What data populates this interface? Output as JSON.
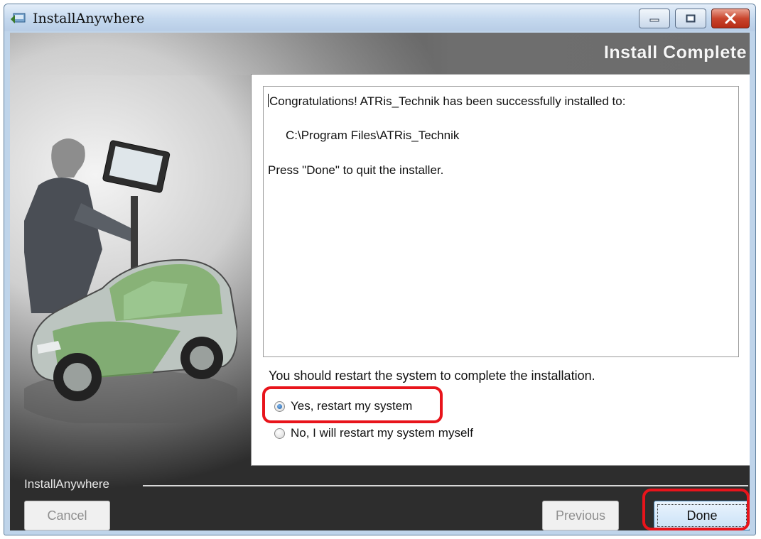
{
  "window": {
    "title": "InstallAnywhere"
  },
  "header": {
    "step_title": "Install Complete"
  },
  "message": {
    "line1": "Congratulations! ATRis_Technik has been successfully installed to:",
    "install_path": "C:\\Program Files\\ATRis_Technik",
    "line3": "Press \"Done\" to quit the installer."
  },
  "restart": {
    "prompt": "You should restart the system to complete the installation.",
    "options": [
      {
        "label": "Yes, restart my system",
        "selected": true
      },
      {
        "label": "No, I will restart my system myself",
        "selected": false
      }
    ]
  },
  "footer": {
    "brand": "InstallAnywhere",
    "cancel_label": "Cancel",
    "previous_label": "Previous",
    "done_label": "Done"
  },
  "colors": {
    "highlight": "#e8141b",
    "done_border": "#3c7fb1",
    "window_frame": "#bfd4ea"
  },
  "icons": [
    "installer-app-icon",
    "minimize-icon",
    "maximize-icon",
    "close-icon"
  ]
}
